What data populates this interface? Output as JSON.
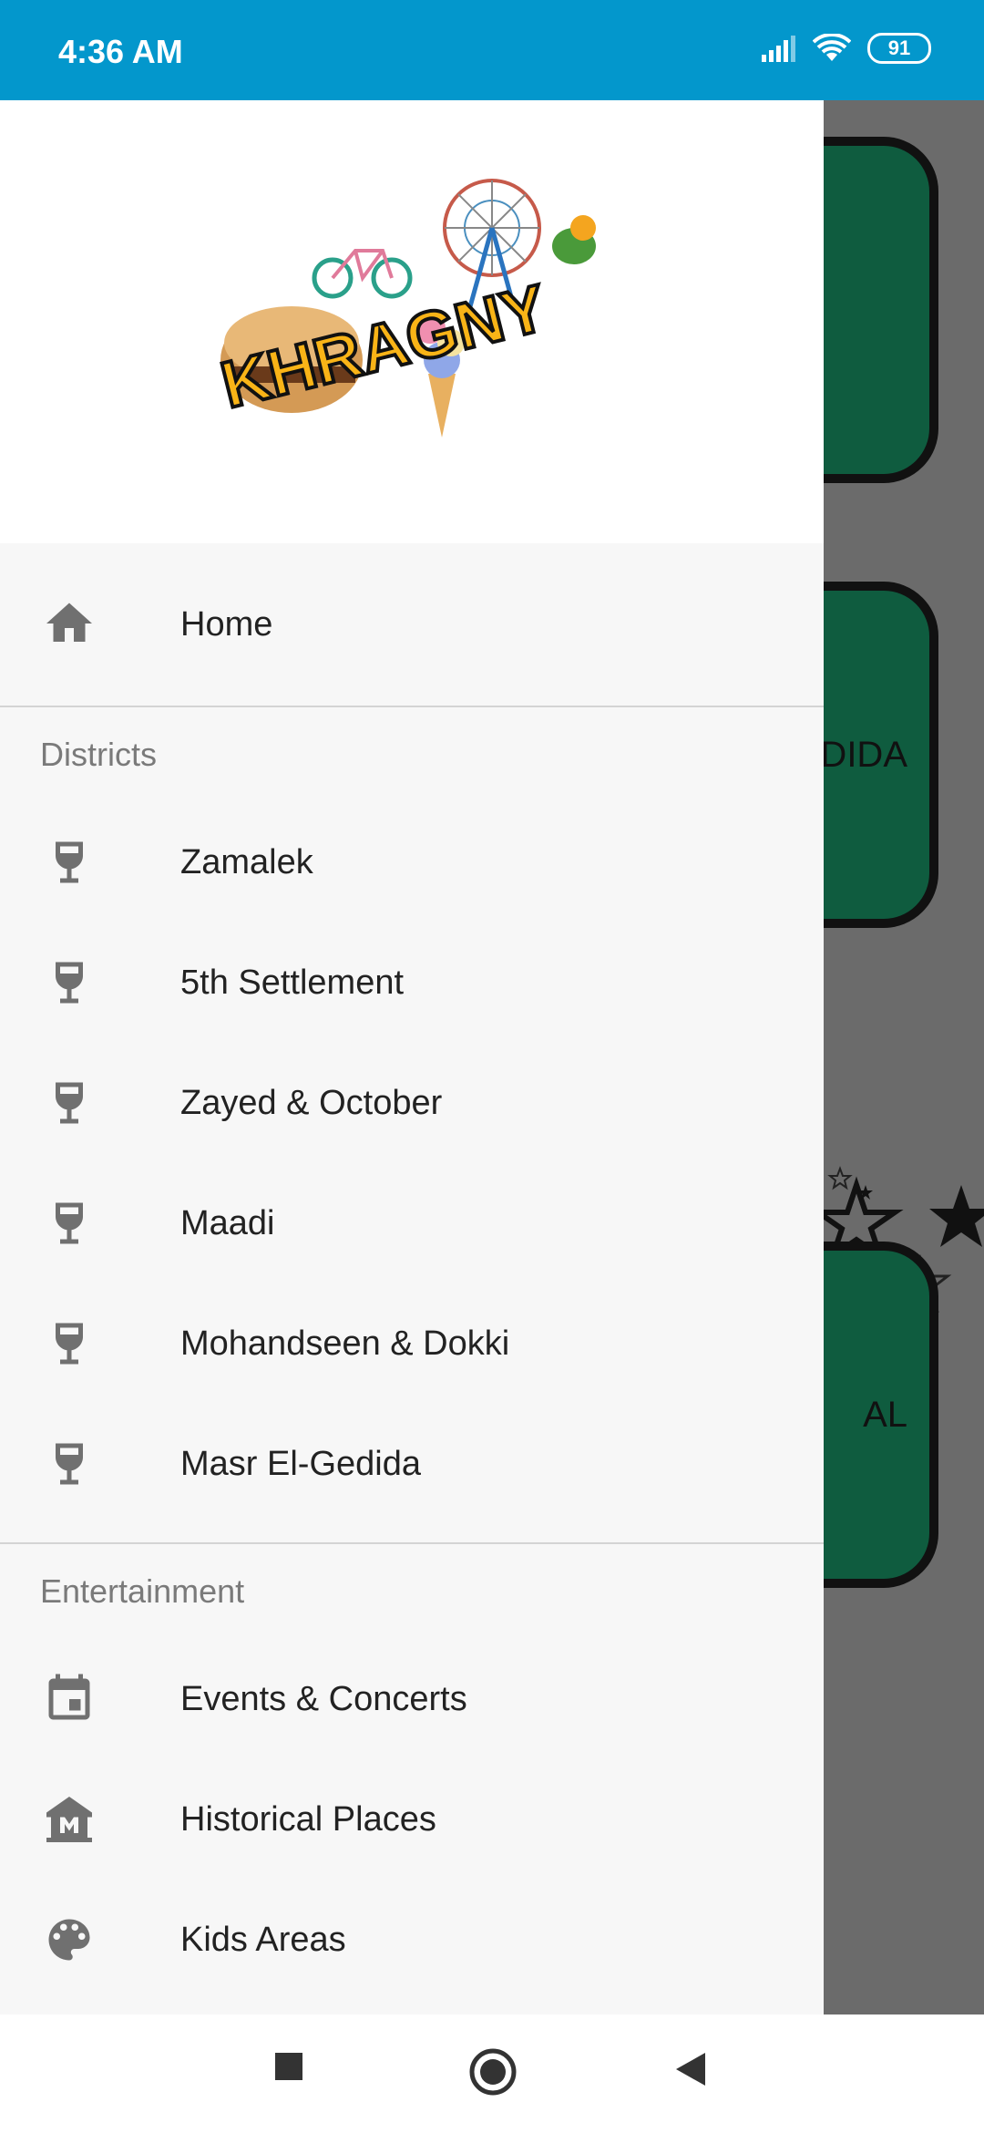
{
  "status_bar": {
    "time": "4:36 AM",
    "battery": "91"
  },
  "background": {
    "cards": [
      {
        "label": ""
      },
      {
        "label": "EDIDA"
      },
      {
        "label": "AL"
      }
    ]
  },
  "drawer": {
    "logo_text": "KHRAGNY",
    "home": {
      "label": "Home",
      "icon": "home-icon"
    },
    "sections": [
      {
        "title": "Districts",
        "items": [
          {
            "label": "Zamalek",
            "icon": "glass-icon"
          },
          {
            "label": "5th Settlement",
            "icon": "glass-icon"
          },
          {
            "label": "Zayed & October",
            "icon": "glass-icon"
          },
          {
            "label": "Maadi",
            "icon": "glass-icon"
          },
          {
            "label": "Mohandseen & Dokki",
            "icon": "glass-icon"
          },
          {
            "label": "Masr El-Gedida",
            "icon": "glass-icon"
          }
        ]
      },
      {
        "title": "Entertainment",
        "items": [
          {
            "label": "Events & Concerts",
            "icon": "calendar-icon"
          },
          {
            "label": "Historical Places",
            "icon": "museum-icon"
          },
          {
            "label": "Kids Areas",
            "icon": "palette-icon"
          }
        ]
      }
    ]
  },
  "colors": {
    "status_bar": "#0397cc",
    "card_green": "#0f5c3f",
    "drawer_bg": "#f7f7f7"
  }
}
